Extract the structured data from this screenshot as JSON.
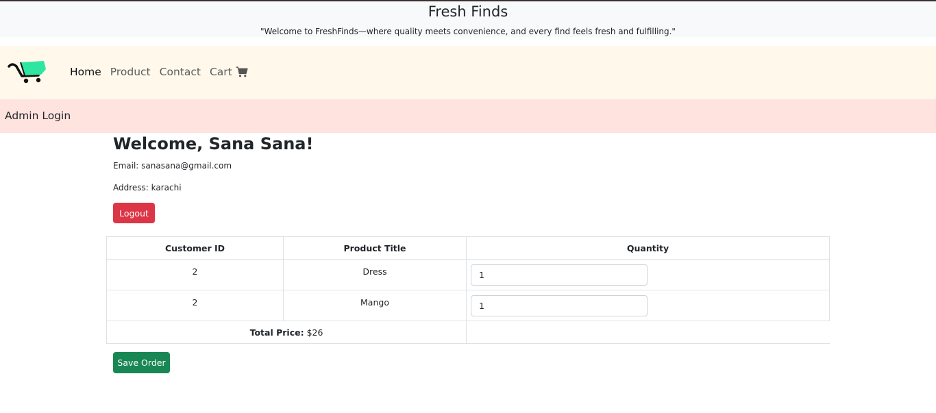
{
  "header": {
    "title": "Fresh Finds",
    "tagline": "\"Welcome to FreshFinds—where quality meets convenience, and every find feels fresh and fulfilling.\""
  },
  "nav": {
    "logo_icon": "shopping-cart-logo-icon",
    "items": [
      {
        "label": "Home",
        "active": true
      },
      {
        "label": "Product",
        "active": false
      },
      {
        "label": "Contact",
        "active": false
      },
      {
        "label": "Cart",
        "active": false,
        "icon": "cart-icon"
      }
    ]
  },
  "admin": {
    "label": "Admin Login"
  },
  "user": {
    "welcome": "Welcome, Sana Sana!",
    "email_line": "Email: sanasana@gmail.com",
    "address_line": "Address: karachi",
    "logout_label": "Logout"
  },
  "orders": {
    "headers": [
      "Customer ID",
      "Product Title",
      "Quantity"
    ],
    "rows": [
      {
        "customer_id": "2",
        "product": "Dress",
        "quantity": "1"
      },
      {
        "customer_id": "2",
        "product": "Mango",
        "quantity": "1"
      }
    ],
    "total_label": "Total Price:",
    "total_value": "$26"
  },
  "actions": {
    "save_label": "Save Order"
  },
  "colors": {
    "danger": "#dc3545",
    "success": "#198754",
    "navbar_bg": "#fff8eb",
    "admin_bar_bg": "#ffe3df",
    "logo_accent": "#2ee6a0"
  }
}
